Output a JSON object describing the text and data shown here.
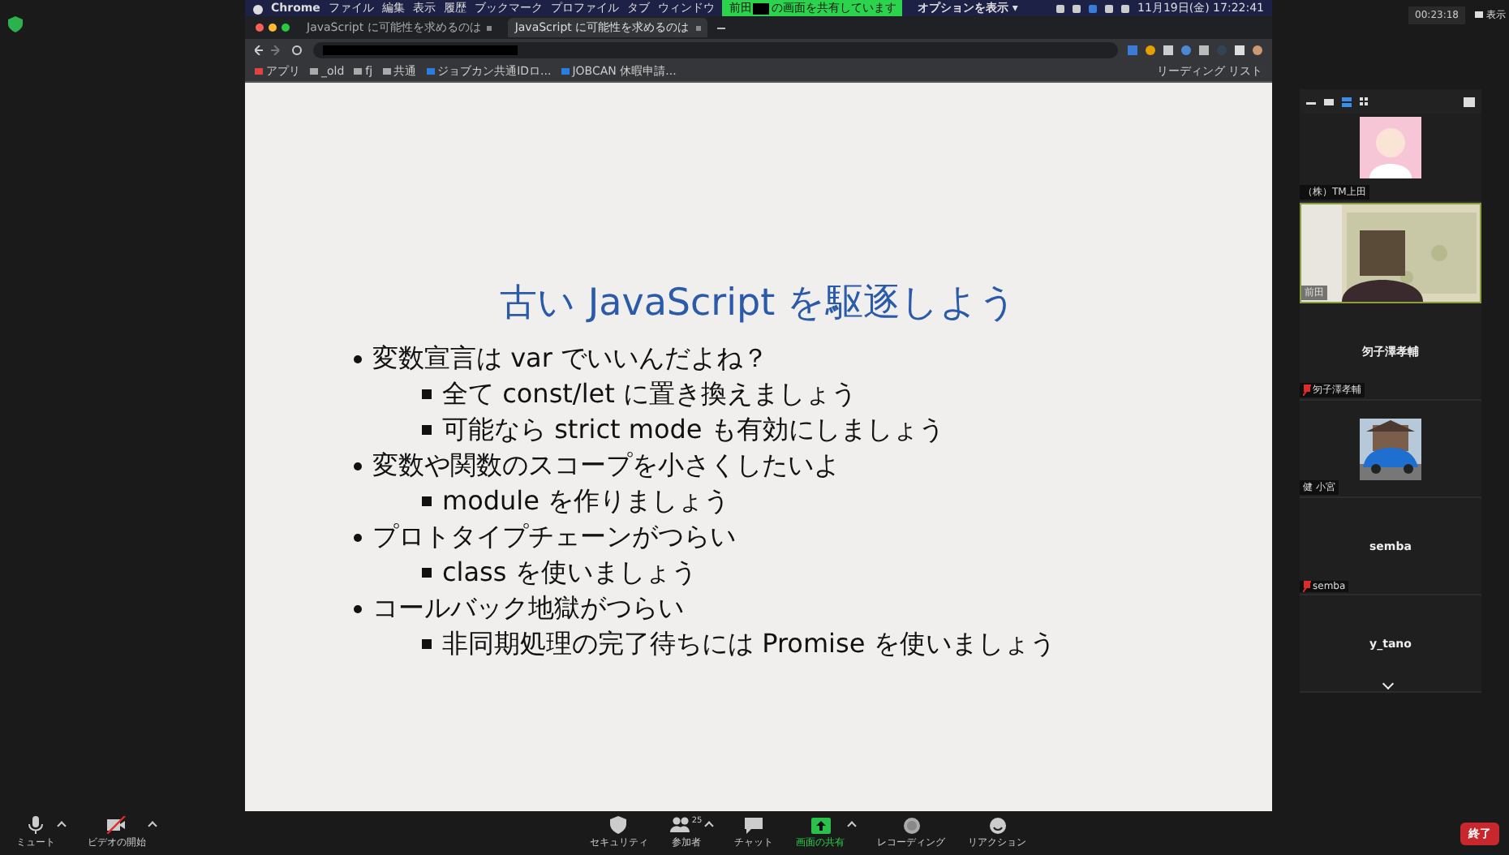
{
  "mac_menu": {
    "items": [
      "Chrome",
      "ファイル",
      "編集",
      "表示",
      "履歴",
      "ブックマーク",
      "プロファイル",
      "タブ",
      "ウィンドウ"
    ],
    "clock": "11月19日(金) 17:22:41"
  },
  "share_banner": {
    "name": "前田",
    "text": "の画面を共有しています",
    "options": "オプションを表示 ▾"
  },
  "browser": {
    "tabs": [
      {
        "title": "JavaScript に可能性を求めるのは",
        "selected": false
      },
      {
        "title": "JavaScript に可能性を求めるのは",
        "selected": true
      }
    ],
    "bookmarks": [
      {
        "label": "アプリ",
        "kind": "apps"
      },
      {
        "label": "_old",
        "kind": "folder"
      },
      {
        "label": "fj",
        "kind": "folder"
      },
      {
        "label": "共通",
        "kind": "folder"
      },
      {
        "label": "ジョブカン共通IDロ...",
        "kind": "site"
      },
      {
        "label": "JOBCAN 休暇申請...",
        "kind": "site"
      }
    ],
    "reading_list": "リーディング リスト"
  },
  "slide": {
    "title": "古い JavaScript を駆逐しよう",
    "bullets": [
      {
        "text": "変数宣言は var でいいんだよね？",
        "children": [
          {
            "text": "全て const/let に置き換えましょう"
          },
          {
            "text": "可能なら strict mode も有効にしましょう"
          }
        ]
      },
      {
        "text": "変数や関数のスコープを小さくしたいよ",
        "children": [
          {
            "text": "module を作りましょう"
          }
        ]
      },
      {
        "text": "プロトタイプチェーンがつらい",
        "children": [
          {
            "text": "class を使いましょう"
          }
        ]
      },
      {
        "text": "コールバック地獄がつらい",
        "children": [
          {
            "text": "非同期処理の完了待ちには Promise を使いましょう"
          }
        ]
      }
    ]
  },
  "meeting": {
    "timer": "00:23:18",
    "view": "表示"
  },
  "participants": [
    {
      "name": "（株）TM上田",
      "kind": "avatar",
      "muted": false
    },
    {
      "name": "前田",
      "kind": "video",
      "muted": false
    },
    {
      "name": "匇子澤孝輔",
      "label": "匇子澤孝輔",
      "kind": "text",
      "muted": true
    },
    {
      "name": "健 小宮",
      "muted": false
    },
    {
      "name": "semba",
      "label": "semba",
      "kind": "text",
      "muted": true
    },
    {
      "name": "y_tano",
      "kind": "text"
    }
  ],
  "toolbar": [
    {
      "label": "ミュート",
      "kind": "mic",
      "caret": true
    },
    {
      "label": "ビデオの開始",
      "kind": "video",
      "caret": true
    },
    {
      "label": "セキュリティ",
      "kind": "shield",
      "caret": false
    },
    {
      "label": "参加者",
      "kind": "people",
      "count": "25",
      "caret": true
    },
    {
      "label": "チャット",
      "kind": "chat",
      "caret": false
    },
    {
      "label": "画面の共有",
      "kind": "share",
      "caret": true,
      "selected": true
    },
    {
      "label": "レコーディング",
      "kind": "record",
      "caret": false
    },
    {
      "label": "リアクション",
      "kind": "reaction",
      "caret": false
    }
  ],
  "end_button": "終了"
}
